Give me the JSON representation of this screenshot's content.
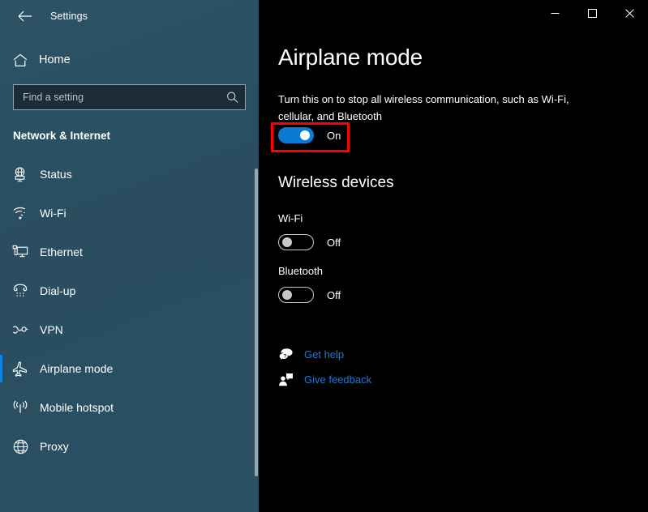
{
  "window": {
    "app_title": "Settings",
    "back_icon": "back-arrow-icon",
    "controls": {
      "minimize_label": "Minimize",
      "maximize_label": "Maximize",
      "close_label": "Close"
    }
  },
  "sidebar": {
    "home": {
      "label": "Home",
      "icon": "home-icon"
    },
    "search": {
      "value": "",
      "placeholder": "Find a setting",
      "icon": "search-icon"
    },
    "section_title": "Network & Internet",
    "accent_color": "#0a84e0",
    "background_color": "#2a4e60",
    "items": [
      {
        "label": "Status",
        "icon": "status-globe-monitor-icon",
        "selected": false
      },
      {
        "label": "Wi-Fi",
        "icon": "wifi-icon",
        "selected": false
      },
      {
        "label": "Ethernet",
        "icon": "ethernet-icon",
        "selected": false
      },
      {
        "label": "Dial-up",
        "icon": "dialup-phone-icon",
        "selected": false
      },
      {
        "label": "VPN",
        "icon": "vpn-key-icon",
        "selected": false
      },
      {
        "label": "Airplane mode",
        "icon": "airplane-icon",
        "selected": true
      },
      {
        "label": "Mobile hotspot",
        "icon": "hotspot-antenna-icon",
        "selected": false
      },
      {
        "label": "Proxy",
        "icon": "proxy-globe-icon",
        "selected": false
      }
    ]
  },
  "main": {
    "title": "Airplane mode",
    "description": "Turn this on to stop all wireless communication, such as Wi-Fi, cellular, and Bluetooth",
    "airplane_toggle": {
      "state_label": "On",
      "on": true,
      "accent_color": "#0a7bd4",
      "highlight_color": "#ff0000"
    },
    "wireless_section": {
      "heading": "Wireless devices",
      "devices": [
        {
          "name": "Wi-Fi",
          "state_label": "Off",
          "on": false
        },
        {
          "name": "Bluetooth",
          "state_label": "Off",
          "on": false
        }
      ]
    },
    "links": [
      {
        "label": "Get help",
        "icon": "help-bubble-icon",
        "color": "#1f7ad4"
      },
      {
        "label": "Give feedback",
        "icon": "feedback-person-icon",
        "color": "#1f7ad4"
      }
    ]
  }
}
